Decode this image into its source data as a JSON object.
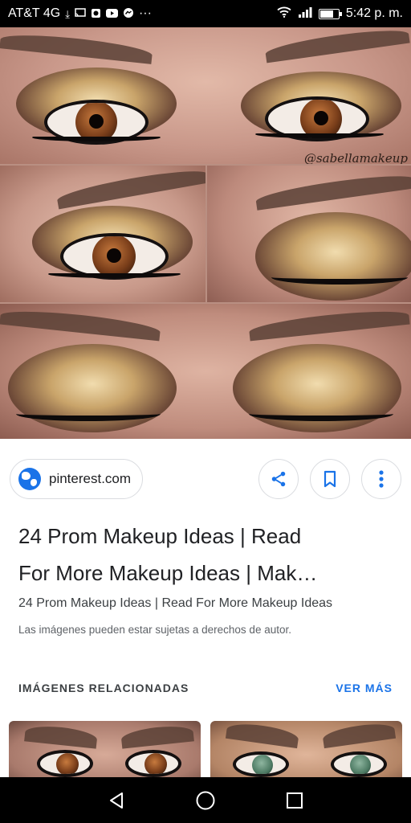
{
  "status_bar": {
    "carrier": "AT&T 4G",
    "notification_icons": [
      "download-icon",
      "cast-icon",
      "whatsapp-icon",
      "youtube-icon",
      "messenger-icon"
    ],
    "more": "···",
    "time": "5:42 p. m.",
    "battery_level": 0.75
  },
  "image": {
    "watermark": "@sabellamakeup"
  },
  "source": {
    "domain": "pinterest.com",
    "icon": "globe-icon"
  },
  "actions": {
    "share_icon": "share-icon",
    "save_icon": "bookmark-icon",
    "more_icon": "more-vert-icon"
  },
  "result": {
    "title_line_1": "24 Prom Makeup Ideas | Read",
    "title_line_2": "For More Makeup Ideas | Mak…",
    "subtitle": "24 Prom Makeup Ideas | Read For More Makeup Ideas",
    "copyright": "Las imágenes pueden estar sujetas a derechos de autor."
  },
  "related": {
    "header": "IMÁGENES RELACIONADAS",
    "see_more": "VER MÁS"
  },
  "colors": {
    "accent": "#1a73e8",
    "text_primary": "#202124",
    "text_secondary": "#5f6368"
  }
}
